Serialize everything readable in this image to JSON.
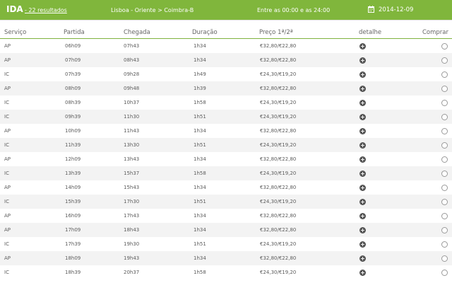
{
  "topbar": {
    "title": "IDA",
    "results": "- 22 resultados",
    "route": "Lisboa - Oriente > Coimbra-B",
    "time_range": "Entre as 00:00 e as 24:00",
    "date": "2014-12-09"
  },
  "table": {
    "headers": [
      "Serviço",
      "Partida",
      "Chegada",
      "Duração",
      "Preço 1ª/2ª",
      "detalhe",
      "Comprar"
    ],
    "rows": [
      {
        "service": "AP",
        "departure": "06h09",
        "arrival": "07h43",
        "duration": "1h34",
        "price": "€32,80/€22,80"
      },
      {
        "service": "AP",
        "departure": "07h09",
        "arrival": "08h43",
        "duration": "1h34",
        "price": "€32,80/€22,80"
      },
      {
        "service": "IC",
        "departure": "07h39",
        "arrival": "09h28",
        "duration": "1h49",
        "price": "€24,30/€19,20"
      },
      {
        "service": "AP",
        "departure": "08h09",
        "arrival": "09h48",
        "duration": "1h39",
        "price": "€32,80/€22,80"
      },
      {
        "service": "IC",
        "departure": "08h39",
        "arrival": "10h37",
        "duration": "1h58",
        "price": "€24,30/€19,20"
      },
      {
        "service": "IC",
        "departure": "09h39",
        "arrival": "11h30",
        "duration": "1h51",
        "price": "€24,30/€19,20"
      },
      {
        "service": "AP",
        "departure": "10h09",
        "arrival": "11h43",
        "duration": "1h34",
        "price": "€32,80/€22,80"
      },
      {
        "service": "IC",
        "departure": "11h39",
        "arrival": "13h30",
        "duration": "1h51",
        "price": "€24,30/€19,20"
      },
      {
        "service": "AP",
        "departure": "12h09",
        "arrival": "13h43",
        "duration": "1h34",
        "price": "€32,80/€22,80"
      },
      {
        "service": "IC",
        "departure": "13h39",
        "arrival": "15h37",
        "duration": "1h58",
        "price": "€24,30/€19,20"
      },
      {
        "service": "AP",
        "departure": "14h09",
        "arrival": "15h43",
        "duration": "1h34",
        "price": "€32,80/€22,80"
      },
      {
        "service": "IC",
        "departure": "15h39",
        "arrival": "17h30",
        "duration": "1h51",
        "price": "€24,30/€19,20"
      },
      {
        "service": "AP",
        "departure": "16h09",
        "arrival": "17h43",
        "duration": "1h34",
        "price": "€32,80/€22,80"
      },
      {
        "service": "AP",
        "departure": "17h09",
        "arrival": "18h43",
        "duration": "1h34",
        "price": "€32,80/€22,80"
      },
      {
        "service": "IC",
        "departure": "17h39",
        "arrival": "19h30",
        "duration": "1h51",
        "price": "€24,30/€19,20"
      },
      {
        "service": "AP",
        "departure": "18h09",
        "arrival": "19h43",
        "duration": "1h34",
        "price": "€32,80/€22,80"
      },
      {
        "service": "IC",
        "departure": "18h39",
        "arrival": "20h37",
        "duration": "1h58",
        "price": "€24,30/€19,20"
      }
    ]
  },
  "icons": {
    "detail": "plus-circle-icon",
    "buy": "radio-button",
    "date": "calendar-icon"
  },
  "colors": {
    "header_green": "#80b63c",
    "header_text": "#ffffff",
    "row_stripe": "#f3f3f3"
  }
}
